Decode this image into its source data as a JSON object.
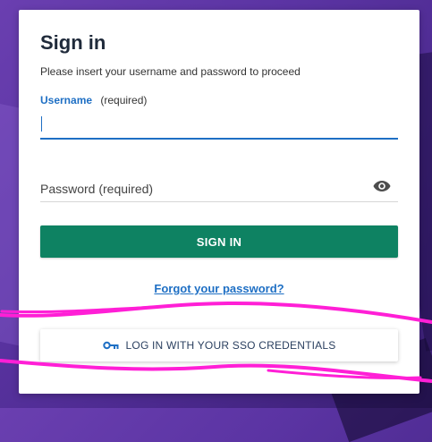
{
  "signin": {
    "title": "Sign in",
    "subtitle": "Please insert your username and password to proceed",
    "username_label": "Username",
    "username_required": "(required)",
    "username_value": "",
    "password_placeholder": "Password (required)",
    "submit_label": "SIGN IN",
    "forgot_label": "Forgot your password?",
    "sso_label": "LOG IN WITH YOUR SSO CREDENTIALS"
  },
  "icons": {
    "password_toggle": "eye-icon",
    "sso": "key-icon"
  },
  "colors": {
    "primary_blue": "#1e6fc4",
    "submit_green": "#0e8262",
    "highlight_magenta": "#ff1fd6",
    "background_purple": "#5b34a3"
  }
}
